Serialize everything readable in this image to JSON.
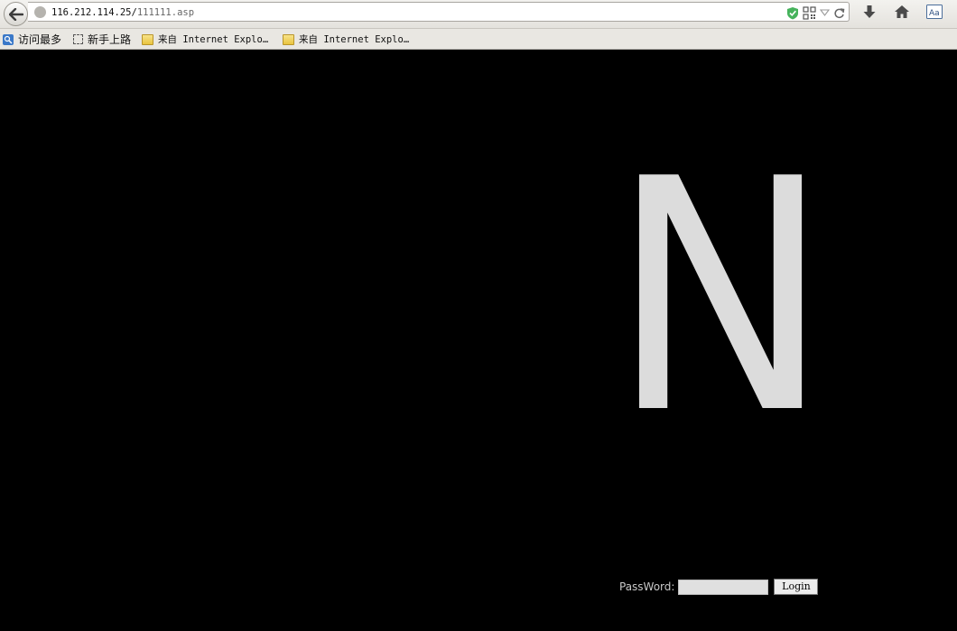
{
  "navbar": {
    "url_host": "116.212.114.25/",
    "url_path": "111111.asp"
  },
  "bookmarks": [
    {
      "label": "访问最多",
      "icon": "most-visited-icon"
    },
    {
      "label": "新手上路",
      "icon": "dashed-page-icon"
    },
    {
      "label": "来自 Internet Explo…",
      "icon": "folder-icon"
    },
    {
      "label": "来自 Internet Explo…",
      "icon": "folder-icon"
    }
  ],
  "page": {
    "logo_letter": "N",
    "logo_color": "#dcdcdc",
    "background": "#000000",
    "password_label": "PassWord:",
    "password_value": "",
    "login_label": "Login"
  }
}
